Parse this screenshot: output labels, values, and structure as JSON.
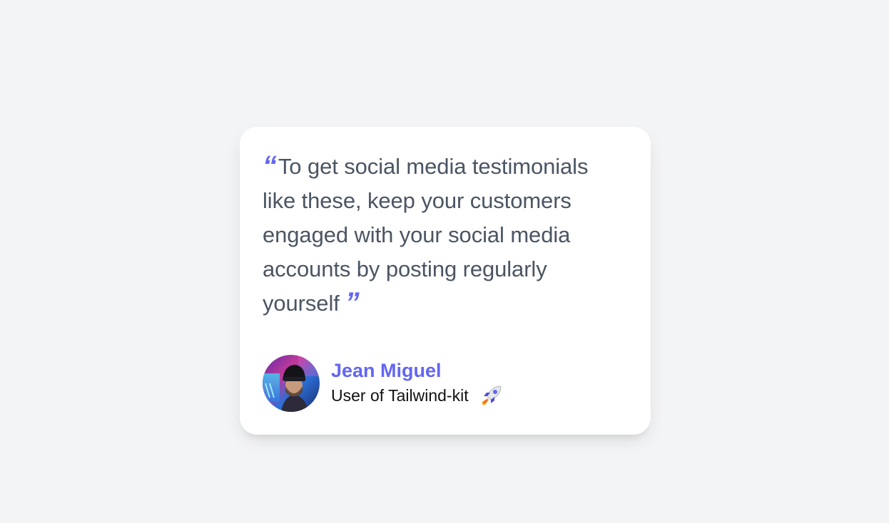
{
  "testimonial": {
    "open_quote": "“",
    "text": "To get social media testimonials like these, keep your customers engaged with your social media accounts by posting regularly yourself",
    "close_quote": "”"
  },
  "author": {
    "name": "Jean Miguel",
    "role": "User of Tailwind-kit",
    "avatar_icon": "user-photo",
    "badge_icon": "rocket-icon"
  },
  "colors": {
    "accent": "#6366f1",
    "background": "#f3f4f6",
    "card": "#ffffff",
    "quote_text": "#4b5563"
  }
}
